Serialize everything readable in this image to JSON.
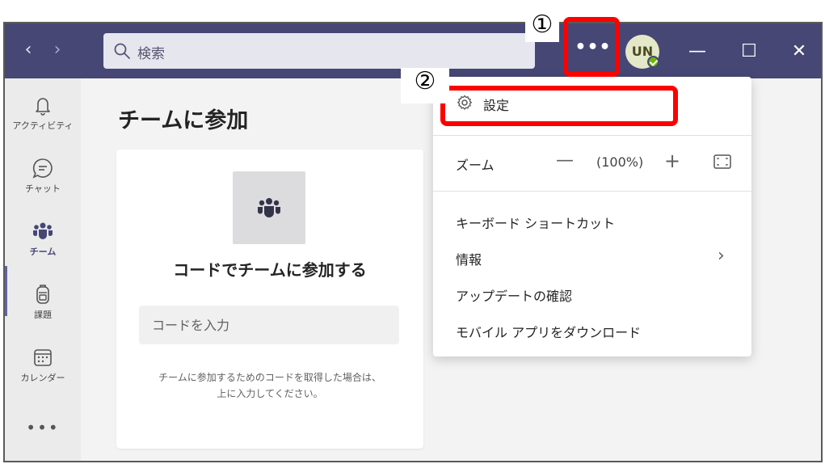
{
  "search": {
    "placeholder": "検索"
  },
  "titlebar": {
    "more_label": "•••",
    "avatar_initials": "UN"
  },
  "window_controls": {
    "minimize": "—",
    "maximize": "☐",
    "close": "✕"
  },
  "rail": {
    "items": [
      {
        "label": "アクティビティ",
        "icon": "bell-icon"
      },
      {
        "label": "チャット",
        "icon": "chat-icon"
      },
      {
        "label": "チーム",
        "icon": "teams-icon"
      },
      {
        "label": "課題",
        "icon": "backpack-icon"
      },
      {
        "label": "カレンダー",
        "icon": "calendar-icon"
      }
    ],
    "more_label": "•••"
  },
  "main": {
    "title": "チームに参加",
    "card": {
      "title": "コードでチームに参加する",
      "input_placeholder": "コードを入力",
      "help_line1": "チームに参加するためのコードを取得した場合は、",
      "help_line2": "上に入力してください。"
    }
  },
  "menu": {
    "settings": "設定",
    "zoom_label": "ズーム",
    "zoom_minus": "—",
    "zoom_value": "(100%)",
    "zoom_plus": "+",
    "keyboard_shortcuts": "キーボード ショートカット",
    "about": "情報",
    "check_updates": "アップデートの確認",
    "download_mobile": "モバイル アプリをダウンロード"
  },
  "annotations": {
    "step1": "①",
    "step2": "②"
  },
  "colors": {
    "titlebar": "#464775",
    "accent": "#6264a7",
    "highlight": "#ff0000",
    "presence": "#6bb700"
  }
}
